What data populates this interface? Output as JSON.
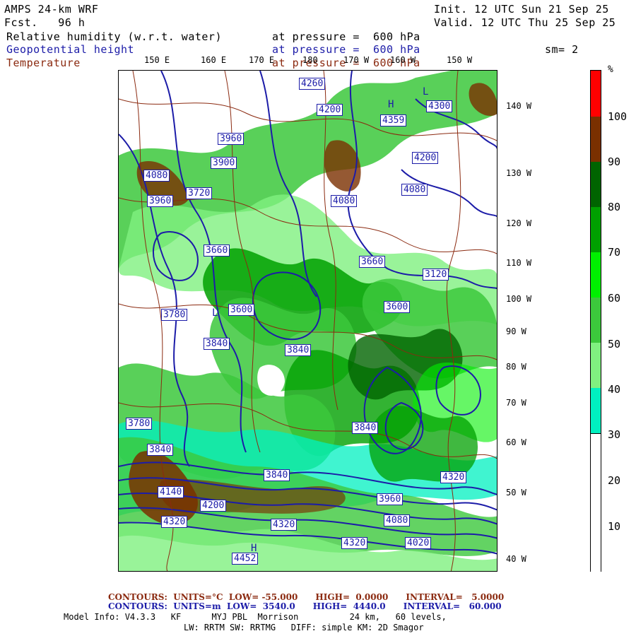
{
  "header": {
    "model": "AMPS 24-km WRF",
    "fcst": "Fcst.   96 h",
    "init": "Init. 12 UTC Sun 21 Sep 25",
    "valid": "Valid. 12 UTC Thu 25 Sep 25",
    "field1": "Relative humidity (w.r.t. water)",
    "field1_level": "at pressure =  600 hPa",
    "field2": "Geopotential height",
    "field2_level": "at pressure =  600 hPa",
    "smoothing": "sm= 2",
    "field3": "Temperature",
    "field3_level": "at pressure =  600 hPa"
  },
  "map": {
    "top_lon_labels": [
      "150 E",
      "160 E",
      "170 E",
      "180",
      "170 W",
      "160 W",
      "150 W"
    ],
    "right_lon_labels": [
      "140 W",
      "130 W",
      "120 W",
      "110 W",
      "100 W",
      "90 W",
      "80 W",
      "70 W",
      "60 W",
      "50 W",
      "40 W"
    ],
    "height_labels": [
      "4260",
      "4200",
      "4080",
      "3960",
      "3900",
      "3840",
      "3780",
      "3720",
      "3660",
      "3600",
      "4140",
      "4320",
      "4452",
      "4359",
      "4300",
      "3960",
      "4020",
      "3120",
      "4320"
    ],
    "high_marker": "H",
    "low_marker": "L",
    "colors": {
      "rh_30": "#00f0c0",
      "rh_40": "#80f080",
      "rh_50": "#3cc83c",
      "rh_60": "#00f000",
      "rh_70": "#00a000",
      "rh_80": "#006400",
      "rh_90": "#7a3000",
      "rh_100": "#ff0000",
      "height_contour": "#1c1ca8",
      "temp_contour": "#8b2a10"
    }
  },
  "colorbar": {
    "unit": "%",
    "labels": [
      "100",
      "90",
      "80",
      "70",
      "60",
      "50",
      "40",
      "30",
      "20",
      "10"
    ]
  },
  "footer": {
    "temp_contours": "CONTOURS:  UNITS=°C  LOW= -55.000      HIGH=  0.0000      INTERVAL=   5.0000",
    "height_contours": "CONTOURS:  UNITS=m  LOW=  3540.0      HIGH=  4440.0      INTERVAL=   60.000",
    "model_info": "Model Info: V4.3.3   KF      MYJ PBL  Morrison          24 km,   60 levels,",
    "model_info2": "LW: RRTM SW: RRTMG   DIFF: simple KM: 2D Smagor"
  }
}
